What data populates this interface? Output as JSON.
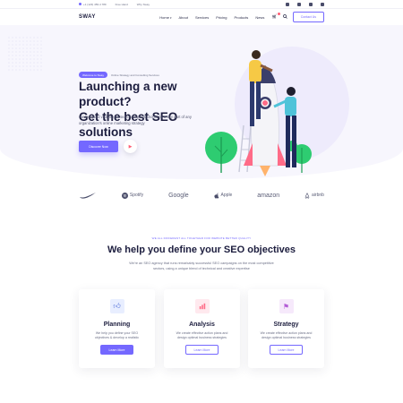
{
  "topbar": {
    "phone": "+1 (123) 456-4 789",
    "help": "Free Hand",
    "why": "Why Sway",
    "socials": [
      "facebook-icon",
      "twitter-icon",
      "instagram-icon",
      "linkedin-icon"
    ]
  },
  "header": {
    "logo": "SWAY",
    "nav": [
      "Home",
      "About",
      "Services",
      "Pricing",
      "Products",
      "News"
    ],
    "contact_label": "Contact Us"
  },
  "hero": {
    "badge": "Welcome to Sway",
    "badge_text": "Online Strategy and Consulting Services",
    "title_line1": "Launching a new product?",
    "title_line2": "Get the best SEO solutions",
    "subtitle": "Having good visibility on search engines should be a key part of any organization's online marketing strategy",
    "cta_label": "Discover Now",
    "play_icon": "play-icon"
  },
  "brands": [
    "Nike",
    "Spotify",
    "Google",
    "Apple",
    "amazon",
    "airbnb"
  ],
  "section": {
    "kicker": "WE ALL DIFFERENT ALL TOGETHER FOR WEBSITE BETTER QUALITY",
    "title": "We help you define your SEO objectives",
    "subtitle": "We're an SEO agency that runs remarkably successful SEO campaigns on the most competitive sectors, using a unique blend of technical and creative expertise"
  },
  "cards": [
    {
      "title": "Planning",
      "text": "We help you define your SEO objectives & develop a realistic",
      "button": "Learn More",
      "icon": "thumbs-up-icon",
      "icon_color": "#4c6bd8",
      "icon_bg": "#e8eeff"
    },
    {
      "title": "Analysis",
      "text": "We create effective action plans and design optimal business strategies",
      "button": "Learn More",
      "icon": "bar-chart-icon",
      "icon_color": "#ff6b87",
      "icon_bg": "#ffe9ee"
    },
    {
      "title": "Strategy",
      "text": "We create effective action plans and design optimal business strategies",
      "button": "Learn More",
      "icon": "flag-icon",
      "icon_color": "#b35cd6",
      "icon_bg": "#f6e9fb"
    }
  ],
  "colors": {
    "accent": "#7468ff",
    "heading": "#1c1d3e",
    "hero_bg": "#f7f6fd"
  }
}
